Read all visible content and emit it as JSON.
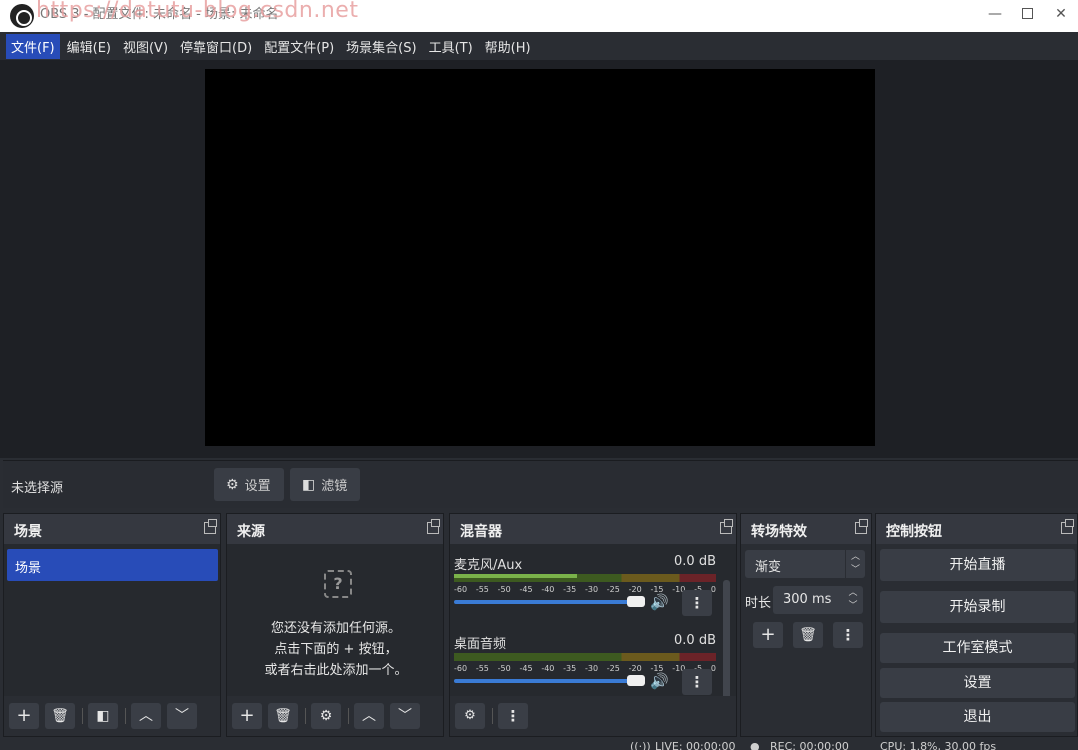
{
  "window": {
    "title": "OBS 3 - 配置文件: 未命名 - 场景: 未命名",
    "watermark": "https://datutu-blog.csdn.net",
    "minimize": "—",
    "close": "✕"
  },
  "menu": [
    {
      "label": "文件(F)"
    },
    {
      "label": "编辑(E)"
    },
    {
      "label": "视图(V)"
    },
    {
      "label": "停靠窗口(D)"
    },
    {
      "label": "配置文件(P)"
    },
    {
      "label": "场景集合(S)"
    },
    {
      "label": "工具(T)"
    },
    {
      "label": "帮助(H)"
    }
  ],
  "source_toolbar": {
    "no_source": "未选择源",
    "settings_label": "设置",
    "filters_label": "滤镜"
  },
  "scenes": {
    "title": "场景",
    "items": [
      "场景"
    ]
  },
  "sources": {
    "title": "来源",
    "empty_lines": [
      "您还没有添加任何源。",
      "点击下面的 + 按钮，",
      "或者右击此处添加一个。"
    ]
  },
  "mixer": {
    "title": "混音器",
    "channels": [
      {
        "name": "麦克风/Aux",
        "db": "0.0 dB",
        "level": 0.47
      },
      {
        "name": "桌面音频",
        "db": "0.0 dB",
        "level": 0.0
      }
    ],
    "ticks": [
      "-60",
      "-55",
      "-50",
      "-45",
      "-40",
      "-35",
      "-30",
      "-25",
      "-20",
      "-15",
      "-10",
      "-5",
      "0"
    ]
  },
  "transitions": {
    "title": "转场特效",
    "selected": "渐变",
    "duration_label": "时长",
    "duration_value": "300 ms"
  },
  "controls": {
    "title": "控制按钮",
    "buttons": [
      "开始直播",
      "开始录制",
      "工作室模式",
      "设置",
      "退出"
    ]
  },
  "status": {
    "live": "LIVE: 00:00:00",
    "rec": "REC: 00:00:00",
    "cpu": "CPU: 1.8%, 30.00 fps"
  },
  "colors": {
    "accent": "#284cb8",
    "panel": "#2a2d33",
    "preview": "#000000"
  }
}
